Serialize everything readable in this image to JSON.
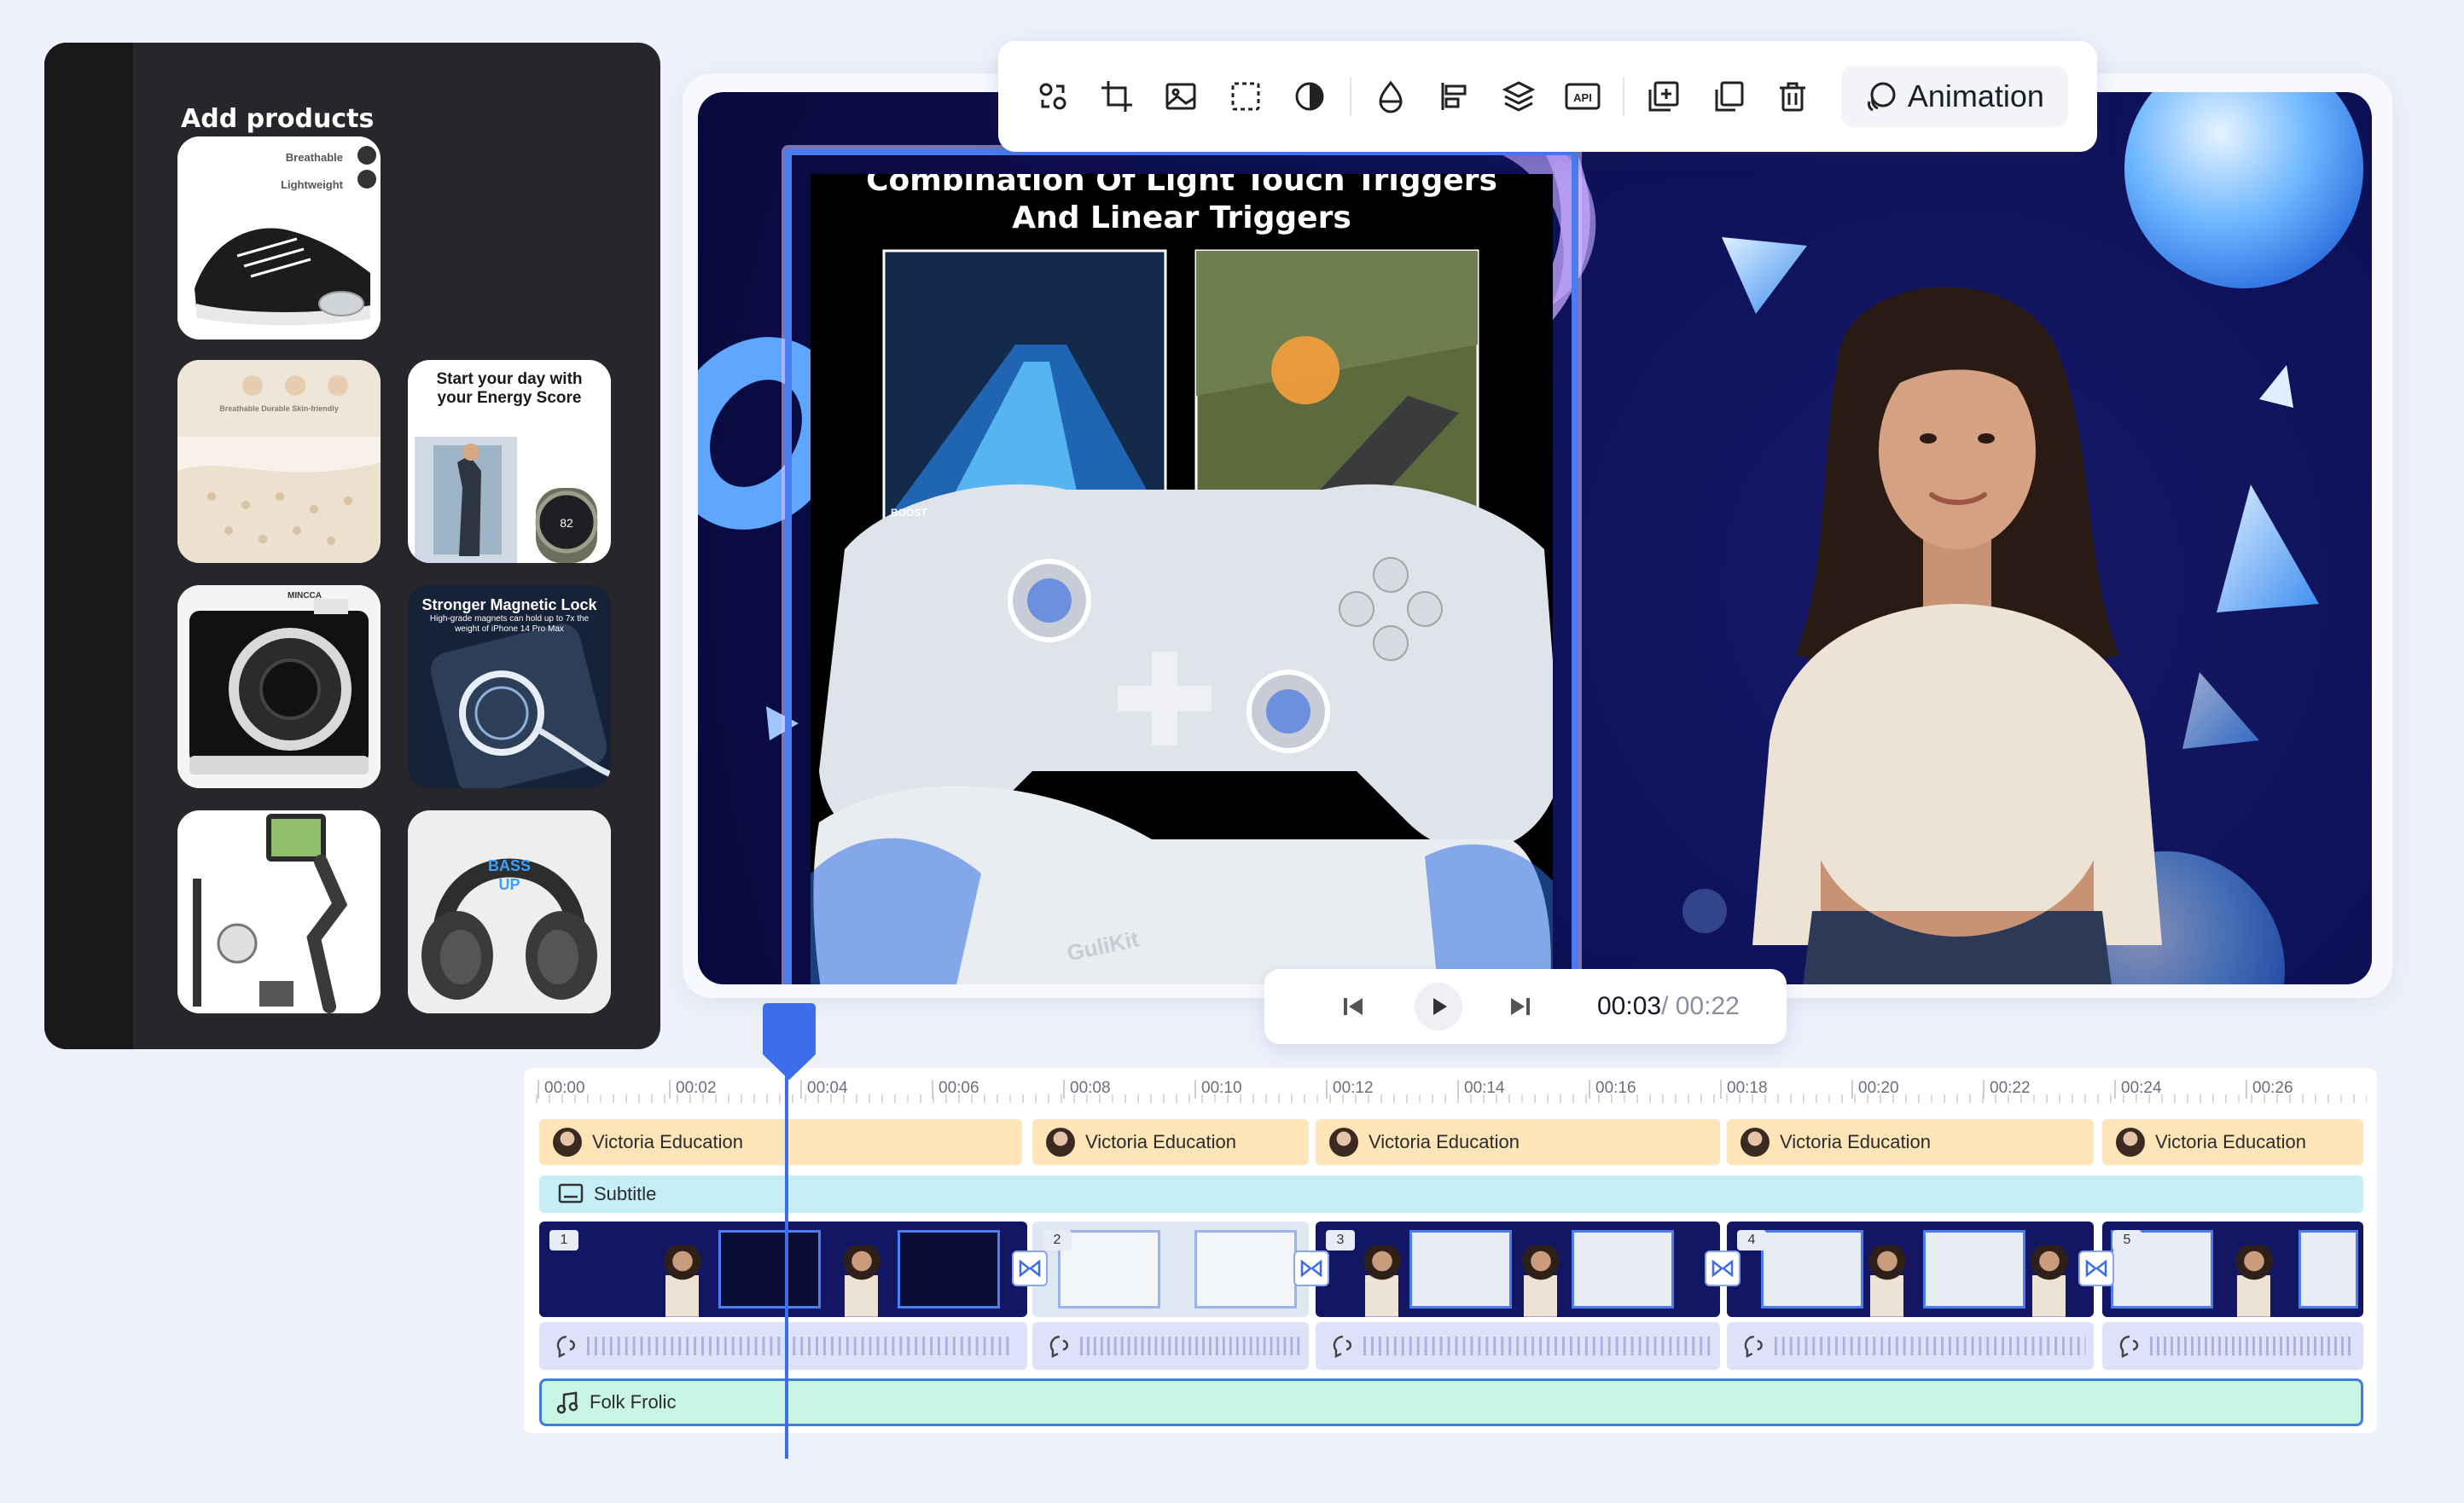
{
  "products_panel": {
    "title": "Add products",
    "items": [
      {
        "name": "sneaker",
        "caption_1": "Breathable",
        "caption_2": "Lightweight"
      },
      {
        "name": "bedding",
        "caption": "Breathable  Durable  Skin-friendly"
      },
      {
        "name": "smartwatch",
        "caption": "Start your day with your Energy Score"
      },
      {
        "name": "instant-camera",
        "caption": "MINCCA"
      },
      {
        "name": "magnetic-charger",
        "caption": "Stronger Magnetic Lock",
        "subcaption": "High-grade magnets can hold up to 7x the weight of iPhone 14 Pro Max"
      },
      {
        "name": "gimbal-stabilizer"
      },
      {
        "name": "headphones",
        "caption": "BASS UP"
      }
    ]
  },
  "toolbar": {
    "icons": [
      "replace-icon",
      "crop-icon",
      "image-icon",
      "selection-icon",
      "contrast-icon",
      "opacity-icon",
      "align-icon",
      "layers-icon",
      "api-icon",
      "add-copy-icon",
      "duplicate-icon",
      "delete-icon"
    ],
    "animation_label": "Animation"
  },
  "preview": {
    "slide_title": "Combination Of Light Touch Triggers And Linear Triggers",
    "boost_label": "BOOST",
    "controller_brand": "GuliKit"
  },
  "playback": {
    "current_time": "00:03",
    "total_time": "/ 00:22"
  },
  "timeline": {
    "ticks": [
      "00:00",
      "00:02",
      "00:04",
      "00:06",
      "00:08",
      "00:10",
      "00:12",
      "00:14",
      "00:16",
      "00:18",
      "00:20",
      "00:22",
      "00:24",
      "00:26"
    ],
    "avatar_clips": [
      "Victoria Education",
      "Victoria Education",
      "Victoria Education",
      "Victoria Education",
      "Victoria Education"
    ],
    "subtitle_label": "Subtitle",
    "scene_numbers": [
      "1",
      "2",
      "3",
      "4",
      "5"
    ],
    "music_label": "Folk Frolic",
    "playhead_time_seconds": 3.5
  },
  "colors": {
    "accent": "#3b6ee8",
    "avatar_track": "#fde5b8",
    "subtitle_track": "#c5eef7",
    "audio_track": "#dde2f8",
    "music_track": "#c8f5e4"
  }
}
